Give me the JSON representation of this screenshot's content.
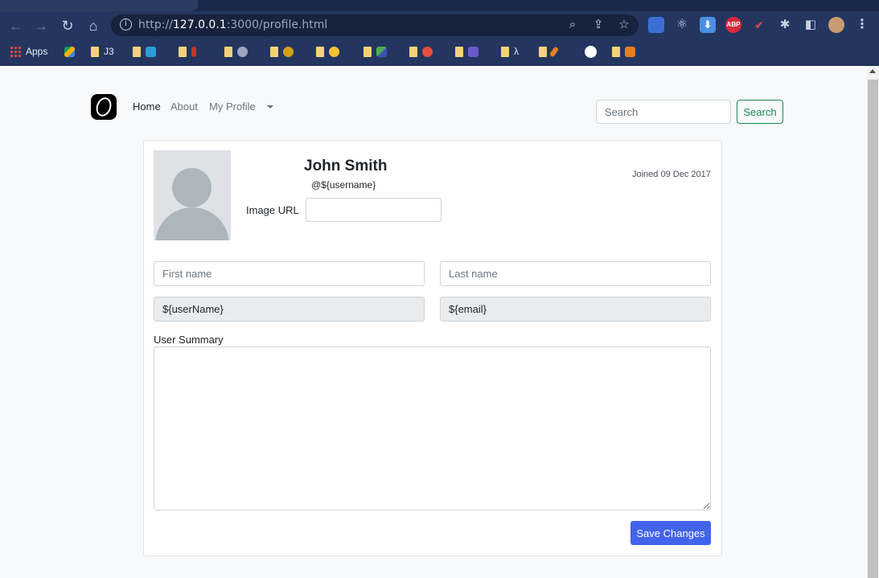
{
  "browser": {
    "url_prefix": "http://",
    "url_host": "127.0.0.1",
    "url_rest": ":3000/profile.html",
    "nav_icons": [
      "back-arrow-icon",
      "forward-arrow-icon",
      "reload-icon",
      "home-icon"
    ],
    "omnibox_icons": [
      "zoom-icon",
      "share-icon",
      "star-icon"
    ],
    "extensions": [
      {
        "name": "shield-extension-icon",
        "color": "#3b6fd6",
        "text": ""
      },
      {
        "name": "react-devtools-icon",
        "color": "transparent",
        "text": "⚛"
      },
      {
        "name": "download-icon",
        "color": "#4a90e2",
        "text": "⬇"
      },
      {
        "name": "adblock-plus-icon",
        "color": "#d6293b",
        "text": "ABP"
      },
      {
        "name": "color-extension-icon",
        "color": "transparent",
        "text": "✔"
      },
      {
        "name": "puzzle-icon",
        "color": "transparent",
        "text": "✱"
      },
      {
        "name": "side-panel-icon",
        "color": "transparent",
        "text": "◧"
      },
      {
        "name": "profile-avatar-icon",
        "color": "#c89b72",
        "text": ""
      },
      {
        "name": "kebab-menu-icon",
        "color": "transparent",
        "text": "⋮"
      }
    ],
    "bookmarks": {
      "apps_label": "Apps",
      "j3_label": "J3",
      "lambda_label": "λ"
    }
  },
  "navbar": {
    "home": "Home",
    "about": "About",
    "my_profile": "My Profile",
    "search_placeholder": "Search",
    "search_button": "Search"
  },
  "profile": {
    "name": "John Smith",
    "handle": "@${username}",
    "joined": "Joined 09 Dec 2017",
    "image_url_label": "Image URL",
    "image_url_value": "",
    "first_name_placeholder": "First name",
    "last_name_placeholder": "Last name",
    "username_value": "${userName}",
    "email_value": "${email}",
    "summary_label": "User Summary",
    "summary_value": "",
    "save_button": "Save Changes"
  }
}
